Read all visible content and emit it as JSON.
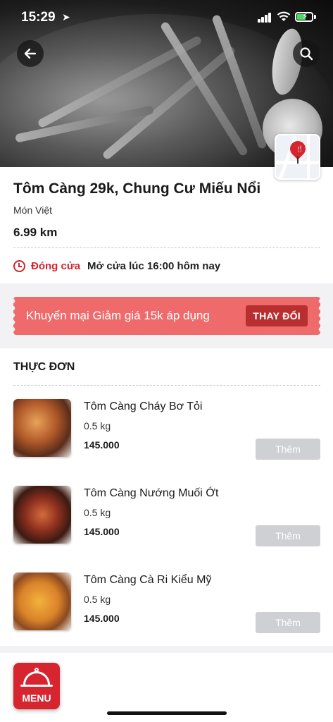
{
  "status_bar": {
    "time": "15:29"
  },
  "hero": {
    "back_icon": "arrow-left-icon",
    "search_icon": "search-icon",
    "map_icon": "map-pin-icon"
  },
  "restaurant": {
    "name": "Tôm Càng 29k, Chung Cư Miếu Nổi",
    "cuisine": "Món Việt",
    "distance": "6.99 km",
    "status": "Đóng cửa",
    "opening": "Mở cửa lúc 16:00 hôm nay"
  },
  "promo": {
    "text": "Khuyến mại Giảm giá 15k áp dụng",
    "button": "THAY ĐỔI"
  },
  "menu": {
    "heading": "THỰC ĐƠN",
    "items": [
      {
        "name": "Tôm Càng Cháy Bơ Tỏi",
        "qty": "0.5 kg",
        "price": "145.000",
        "button": "Thêm"
      },
      {
        "name": "Tôm Càng Nướng Muối Ớt",
        "qty": "0.5 kg",
        "price": "145.000",
        "button": "Thêm"
      },
      {
        "name": "Tôm Càng Cà Ri Kiểu Mỹ",
        "qty": "0.5 kg",
        "price": "145.000",
        "button": "Thêm"
      }
    ]
  },
  "fab": {
    "label": "MENU"
  },
  "colors": {
    "accent": "#d6252f",
    "promo": "#ef6b6b",
    "promo_button": "#b82f30",
    "add_button": "#cfd0d4"
  }
}
